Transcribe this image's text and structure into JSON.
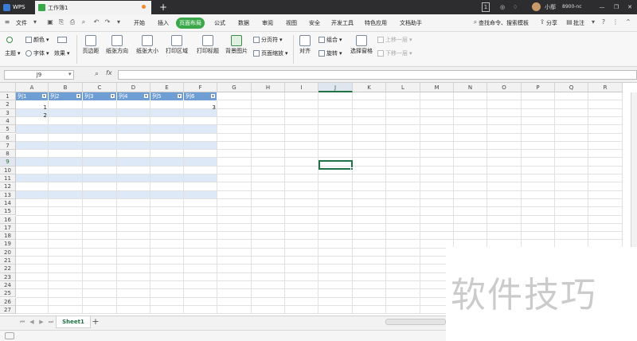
{
  "titlebar": {
    "app": "WPS",
    "doc_tab": "工作簿1",
    "page_badge": "1",
    "user": "小鄢",
    "user_id": "8900-nc",
    "buttons": [
      "—",
      "❐",
      "✕"
    ]
  },
  "menubar": {
    "file": "文件",
    "tabs": [
      "开始",
      "插入",
      "页面布局",
      "公式",
      "数据",
      "审阅",
      "视图",
      "安全",
      "开发工具",
      "特色应用",
      "文档助手"
    ],
    "active_tab": "页面布局",
    "search": "查找命令、搜索模板",
    "share": "分享",
    "comment": "批注"
  },
  "ribbon": {
    "theme": "主题",
    "colors": "颜色",
    "fonts": "字体",
    "effects": "效果",
    "margins": "页边距",
    "orientation": "纸张方向",
    "size": "纸张大小",
    "print_area": "打印区域",
    "print_titles": "打印标题",
    "background": "背景图片",
    "breaks": "分页符",
    "page_zoom": "页面缩放",
    "align": "对齐",
    "group": "组合",
    "rotate": "旋转",
    "selection_pane": "选择窗格",
    "bring_forward": "上移一层",
    "send_backward": "下移一层"
  },
  "formulabar": {
    "namebox": "J9",
    "fx": "fx",
    "value": ""
  },
  "grid": {
    "columns": [
      "A",
      "B",
      "C",
      "D",
      "E",
      "F",
      "G",
      "H",
      "I",
      "J",
      "K",
      "L",
      "M",
      "N",
      "O",
      "P",
      "Q",
      "R"
    ],
    "rows": [
      "1",
      "2",
      "3",
      "4",
      "5",
      "6",
      "7",
      "8",
      "9",
      "10",
      "11",
      "12",
      "13",
      "14",
      "15",
      "16",
      "17",
      "18",
      "19",
      "20",
      "21",
      "22",
      "23",
      "24",
      "25",
      "26",
      "27"
    ],
    "selected_column": "J",
    "selected_row": "9",
    "table_headers": [
      "列1",
      "列2",
      "列3",
      "列4",
      "列5",
      "列6"
    ],
    "cells": {
      "A2": "1",
      "A3": "2",
      "F2": "3"
    }
  },
  "sheets": {
    "tabs": [
      "Sheet1"
    ],
    "add": "+"
  },
  "watermark": "软件技巧",
  "colors": {
    "accent": "#3aa84a",
    "table_header": "#6f9ed4",
    "table_band": "#dde9f6",
    "selection": "#217346"
  }
}
